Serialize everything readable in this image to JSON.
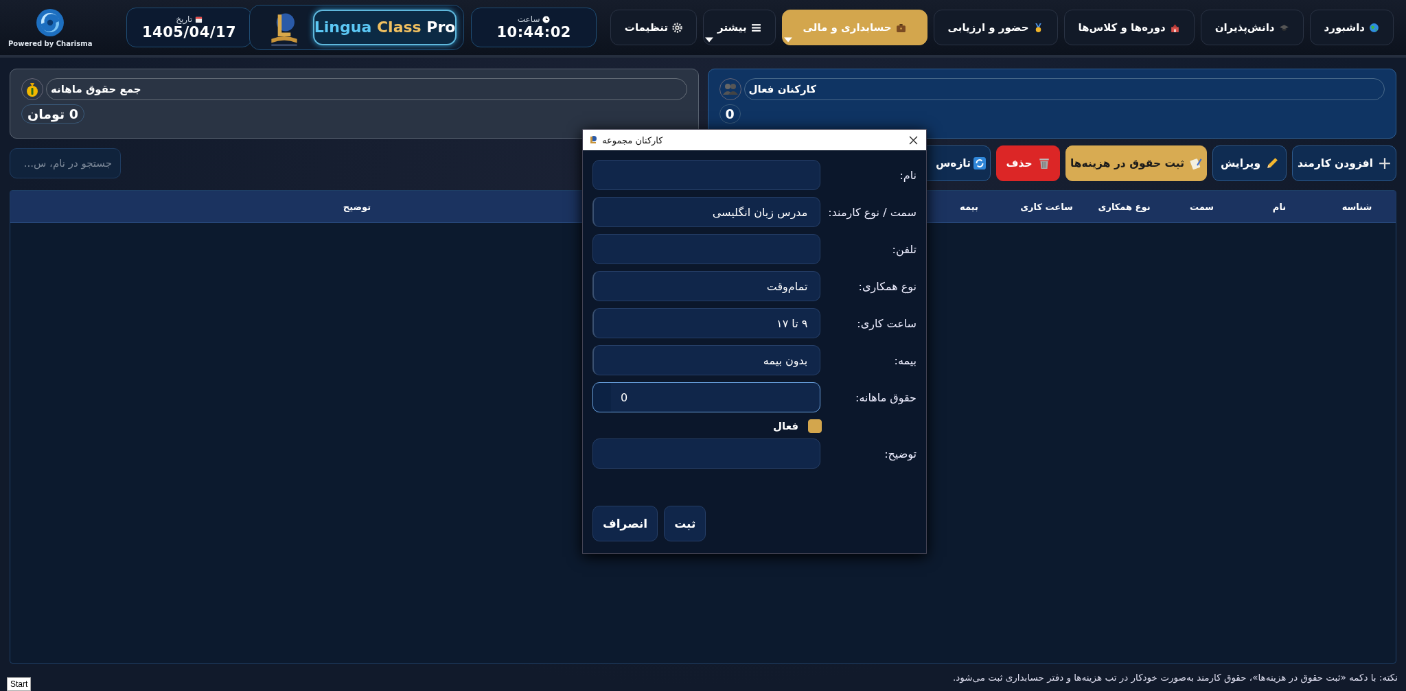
{
  "brand": {
    "powered_by": "Powered by Charisma",
    "date_label": "تاریخ",
    "date": "1405/04/17",
    "name": "Lingua Class Pro",
    "time_label": "ساعت",
    "time": "10:44:02"
  },
  "nav": [
    {
      "label": "داشبورد",
      "selected": false,
      "dropdown": false
    },
    {
      "label": "دانش‌پذیران",
      "selected": false,
      "dropdown": false
    },
    {
      "label": "دوره‌ها و کلاس‌ها",
      "selected": false,
      "dropdown": false
    },
    {
      "label": "حضور و ارزیابی",
      "selected": false,
      "dropdown": false
    },
    {
      "label": "حسابداری و مالی",
      "selected": true,
      "dropdown": true
    },
    {
      "label": "بیشتر",
      "selected": false,
      "dropdown": true
    },
    {
      "label": "تنظیمات",
      "selected": false,
      "dropdown": false
    }
  ],
  "summary": [
    {
      "title": "کارکنان فعال",
      "value": "0",
      "kind": "staff"
    },
    {
      "title": "جمع حقوق ماهانه",
      "value": "0 تومان",
      "kind": "salary"
    }
  ],
  "toolbar": [
    {
      "label": "افزودن کارمند",
      "kind": "default"
    },
    {
      "label": "ویرایش",
      "kind": "default"
    },
    {
      "label": "ثبت حقوق در هزینه‌ها",
      "kind": "accent"
    },
    {
      "label": "حذف",
      "kind": "danger"
    },
    {
      "label": "تازه‌س",
      "kind": "default"
    }
  ],
  "search": {
    "placeholder": "جستجو در نام، س..."
  },
  "table": {
    "columns": [
      "شناسه",
      "نام",
      "سمت",
      "نوع همکاری",
      "ساعت کاری",
      "بیمه",
      "توضیح"
    ]
  },
  "dialog": {
    "title": "کارکنان مجموعه",
    "fields": [
      {
        "label": "نام:",
        "kind": "text",
        "focused": false
      },
      {
        "label": "سمت / نوع کارمند:",
        "kind": "text",
        "value": "مدرس زبان انگلیسی",
        "focused": false
      },
      {
        "label": "تلفن:",
        "kind": "text",
        "focused": false
      },
      {
        "label": "نوع همکاری:",
        "kind": "text",
        "value": "تمام‌وقت",
        "focused": false
      },
      {
        "label": "ساعت کاری:",
        "kind": "text",
        "value": "۹ تا ۱۷",
        "focused": false
      },
      {
        "label": "بیمه:",
        "kind": "text",
        "value": "بدون بیمه",
        "focused": false
      },
      {
        "label": "حقوق ماهانه:",
        "kind": "number",
        "value": "0",
        "focused": true
      },
      {
        "label": "فعال",
        "kind": "checkbox",
        "checked": true
      },
      {
        "label": "توضیح:",
        "kind": "text",
        "focused": false
      }
    ],
    "buttons": [
      "ثبت",
      "انصراف"
    ]
  },
  "note": "نکته: با دکمه «ثبت حقوق در هزینه‌ها»، حقوق کارمند به‌صورت خودکار در تب هزینه‌ها و دفتر حسابداری ثبت می‌شود.",
  "taskbar": {
    "start": "Start"
  }
}
